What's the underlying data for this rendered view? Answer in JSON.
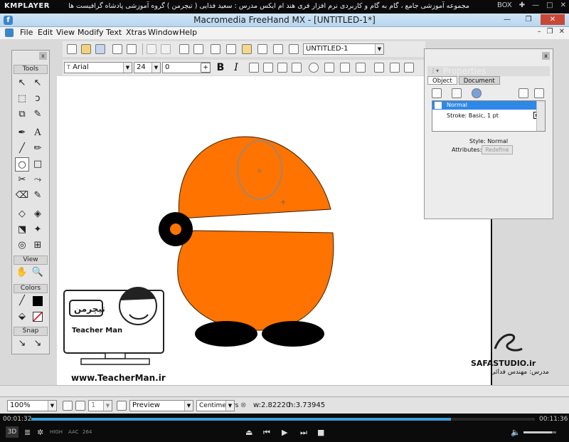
{
  "player": {
    "logo": "KMPLAYER",
    "caption": "مجموعه آموزشی جامع ، گام به گام و کاربردی نرم افزار فری هند ام ایکس  مدرس : سعید فدایی ( تیچرمن ) گروه آموزشی پادشاه گرافیست ها",
    "box_label": "BOX",
    "time_elapsed": "00:01:32",
    "time_total": "00:11:36",
    "progress": 0.834,
    "bottom_tags": [
      "HIGH",
      "AAC",
      "264"
    ]
  },
  "app": {
    "title": "Macromedia FreeHand MX - [UNTITLED-1*]",
    "menu": [
      "File",
      "Edit",
      "View",
      "Modify",
      "Text",
      "Xtras",
      "Window",
      "Help"
    ]
  },
  "toolbar": {
    "document_name": "UNTITLED-1",
    "font_name": "Arial",
    "font_size": "24",
    "leading": "0",
    "format_buttons": [
      "B",
      "I"
    ]
  },
  "tools_panel": {
    "title": "Tools",
    "view_label": "View",
    "colors_label": "Colors",
    "snap_label": "Snap"
  },
  "properties": {
    "title": "Properties",
    "tabs": [
      "Object",
      "Document"
    ],
    "row_normal": "Normal",
    "row_stroke": "Stroke: Basic, 1 pt",
    "style_text": "Style: Normal",
    "attributes_label": "Attributes:",
    "redefine_label": "Redefine"
  },
  "status": {
    "zoom": "100%",
    "page": "1",
    "render_mode": "Preview",
    "units": "Centimeters",
    "width": "w:2.82220",
    "height": "h:3.73945"
  },
  "watermarks": {
    "teacher_name": "Teacher Man",
    "teacher_url": "www.TeacherMan.ir",
    "studio": "SAFASTUDIO.ir",
    "studio_sub": "مدرس: مهندس فدائی"
  },
  "colors": {
    "body_orange": "#ff7300",
    "selection_blue": "#2e88e8",
    "feet": "#000000"
  }
}
